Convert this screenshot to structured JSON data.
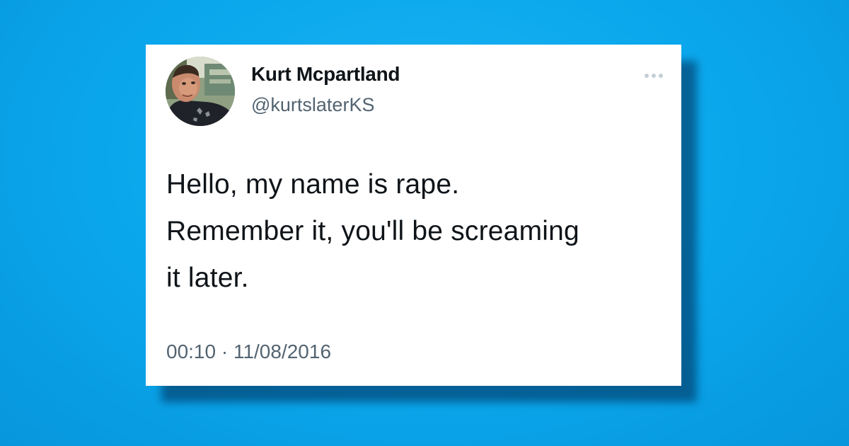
{
  "tweet": {
    "author": {
      "display_name": "Kurt Mcpartland",
      "handle": "@kurtslaterKS",
      "avatar": "profile-photo"
    },
    "menu_icon": "more-horizontal-icon",
    "text": "Hello, my name is rape.\nRemember it, you'll be screaming\nit later.",
    "timestamp": "00:10 · 11/08/2016"
  },
  "colors": {
    "background": "#0aa6ec",
    "card": "#ffffff",
    "primary_text": "#0f1419",
    "secondary_text": "#536471"
  }
}
